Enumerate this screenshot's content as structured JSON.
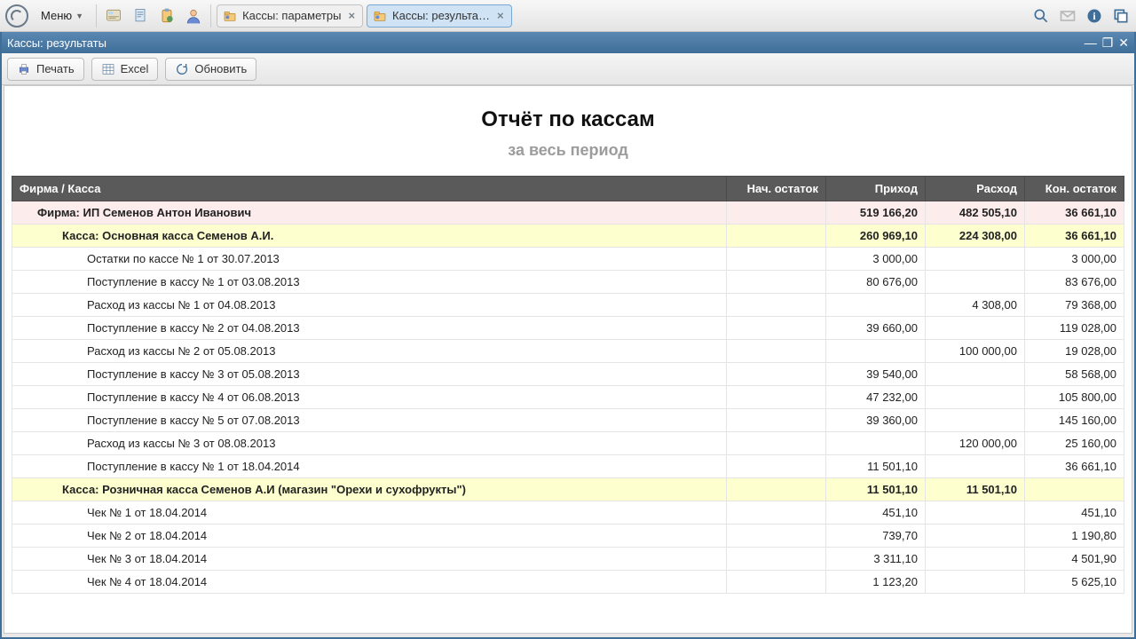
{
  "topbar": {
    "menu_label": "Меню",
    "tabs": [
      {
        "label": "Кассы: параметры",
        "active": false
      },
      {
        "label": "Кассы: результа…",
        "active": true
      }
    ]
  },
  "window": {
    "title": "Кассы: результаты"
  },
  "buttons": {
    "print": "Печать",
    "excel": "Excel",
    "refresh": "Обновить"
  },
  "report": {
    "title": "Отчёт по кассам",
    "subtitle": "за весь период",
    "columns": {
      "name": "Фирма / Касса",
      "start": "Нач. остаток",
      "in": "Приход",
      "out": "Расход",
      "end": "Кон. остаток"
    },
    "rows": [
      {
        "type": "firm",
        "name": "Фирма: ИП Семенов Антон Иванович",
        "start": "",
        "in": "519 166,20",
        "out": "482 505,10",
        "end": "36 661,10"
      },
      {
        "type": "kassa",
        "name": "Касса: Основная касса Семенов А.И.",
        "start": "",
        "in": "260 969,10",
        "out": "224 308,00",
        "end": "36 661,10"
      },
      {
        "type": "op",
        "name": "Остатки по кассе № 1 от 30.07.2013",
        "start": "",
        "in": "3 000,00",
        "out": "",
        "end": "3 000,00"
      },
      {
        "type": "op",
        "name": "Поступление в кассу № 1 от 03.08.2013",
        "start": "",
        "in": "80 676,00",
        "out": "",
        "end": "83 676,00"
      },
      {
        "type": "op",
        "name": "Расход из кассы № 1 от 04.08.2013",
        "start": "",
        "in": "",
        "out": "4 308,00",
        "end": "79 368,00"
      },
      {
        "type": "op",
        "name": "Поступление в кассу № 2 от 04.08.2013",
        "start": "",
        "in": "39 660,00",
        "out": "",
        "end": "119 028,00"
      },
      {
        "type": "op",
        "name": "Расход из кассы № 2 от 05.08.2013",
        "start": "",
        "in": "",
        "out": "100 000,00",
        "end": "19 028,00"
      },
      {
        "type": "op",
        "name": "Поступление в кассу № 3 от 05.08.2013",
        "start": "",
        "in": "39 540,00",
        "out": "",
        "end": "58 568,00"
      },
      {
        "type": "op",
        "name": "Поступление в кассу № 4 от 06.08.2013",
        "start": "",
        "in": "47 232,00",
        "out": "",
        "end": "105 800,00"
      },
      {
        "type": "op",
        "name": "Поступление в кассу № 5 от 07.08.2013",
        "start": "",
        "in": "39 360,00",
        "out": "",
        "end": "145 160,00"
      },
      {
        "type": "op",
        "name": "Расход из кассы № 3 от 08.08.2013",
        "start": "",
        "in": "",
        "out": "120 000,00",
        "end": "25 160,00"
      },
      {
        "type": "op",
        "name": "Поступление в кассу № 1 от 18.04.2014",
        "start": "",
        "in": "11 501,10",
        "out": "",
        "end": "36 661,10"
      },
      {
        "type": "kassa",
        "name": "Касса: Розничная касса Семенов А.И (магазин \"Орехи и сухофрукты\")",
        "start": "",
        "in": "11 501,10",
        "out": "11 501,10",
        "end": ""
      },
      {
        "type": "op",
        "name": "Чек № 1 от 18.04.2014",
        "start": "",
        "in": "451,10",
        "out": "",
        "end": "451,10"
      },
      {
        "type": "op",
        "name": "Чек № 2 от 18.04.2014",
        "start": "",
        "in": "739,70",
        "out": "",
        "end": "1 190,80"
      },
      {
        "type": "op",
        "name": "Чек № 3 от 18.04.2014",
        "start": "",
        "in": "3 311,10",
        "out": "",
        "end": "4 501,90"
      },
      {
        "type": "op",
        "name": "Чек № 4 от 18.04.2014",
        "start": "",
        "in": "1 123,20",
        "out": "",
        "end": "5 625,10"
      }
    ]
  }
}
